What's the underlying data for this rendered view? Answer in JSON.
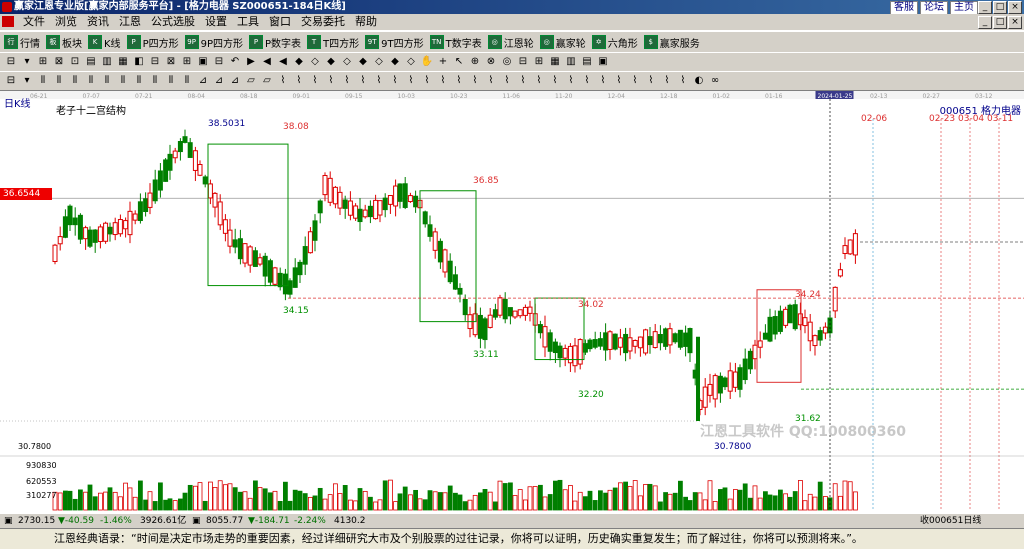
{
  "window": {
    "title": "赢家江恩专业版[赢家内部服务平台] - [格力电器  SZ000651-184日K线]",
    "links": [
      "客服",
      "论坛",
      "主页"
    ],
    "controls": [
      "_",
      "□",
      "×"
    ]
  },
  "menu": {
    "items": [
      "文件",
      "浏览",
      "资讯",
      "江恩",
      "公式选股",
      "设置",
      "工具",
      "窗口",
      "交易委托",
      "帮助"
    ]
  },
  "toolbar1": {
    "items": [
      {
        "icon": "行",
        "label": "行情"
      },
      {
        "icon": "板",
        "label": "板块"
      },
      {
        "icon": "K",
        "label": "K线"
      },
      {
        "icon": "P",
        "label": "P四方形"
      },
      {
        "icon": "9P",
        "label": "9P四方形"
      },
      {
        "icon": "P",
        "label": "P数字表"
      },
      {
        "icon": "T",
        "label": "T四方形"
      },
      {
        "icon": "9T",
        "label": "9T四方形"
      },
      {
        "icon": "TN",
        "label": "T数字表"
      },
      {
        "icon": "◎",
        "label": "江恩轮"
      },
      {
        "icon": "◎",
        "label": "赢家轮"
      },
      {
        "icon": "✡",
        "label": "六角形"
      },
      {
        "icon": "$",
        "label": "赢家服务"
      }
    ]
  },
  "chart": {
    "period_label": "日K线",
    "structure_title": "老子十二宫结构",
    "stock_label": "000651 格力电器",
    "current_price_tag": "36.6544",
    "watermark": "江恩工具软件 QQ:100800360",
    "dates_top": [
      "06-21",
      "07-07",
      "07-21",
      "08-04",
      "08-18",
      "09-01",
      "09-15",
      "10-03",
      "10-23",
      "11-06",
      "11-20",
      "12-04",
      "12-18",
      "01-02",
      "01-16",
      "2024-01-25",
      "02-13",
      "02-27",
      "03-12"
    ],
    "future_dates": [
      "02-06",
      "02-23",
      "03-04",
      "03-11"
    ],
    "annotations": [
      "38.5031",
      "38.08",
      "36.85",
      "34.15",
      "33.11",
      "34.02",
      "32.20",
      "34.24",
      "31.62",
      "30.7800"
    ],
    "volume_labels": [
      "930830",
      "620553",
      "310277"
    ],
    "low_label": "30.7800",
    "colors": {
      "up": "#dd0000",
      "down": "#007f00",
      "box_green": "#009000",
      "box_red": "#dd3030",
      "cursor": "#000000"
    }
  },
  "status": {
    "sh_value": "2730.15",
    "sh_change": "▼-40.59",
    "sh_pct": "-1.46%",
    "sh_amount": "3926.61亿",
    "sz_value": "8055.77",
    "sz_change": "▼-184.71",
    "sz_pct": "-2.24%",
    "sz_amount": "4130.2",
    "right_label": "收000651日线"
  },
  "quote": {
    "text": "江恩经典语录：“时间是决定市场走势的重要因素，经过详细研究大市及个别股票的过往记录，你将可以证明，历史确实重复发生；而了解过往，你将可以预测将来。”。"
  }
}
